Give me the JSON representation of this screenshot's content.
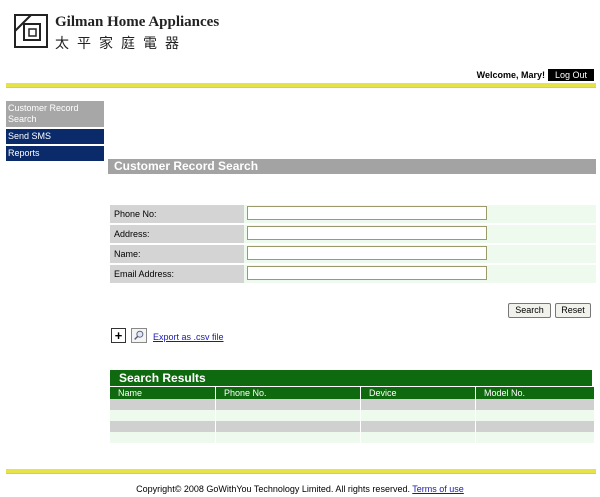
{
  "brand": {
    "name_en": "Gilman Home Appliances",
    "name_zh": "太平家庭電器"
  },
  "header": {
    "welcome": "Welcome, Mary!",
    "logout_label": "Log Out"
  },
  "sidebar": {
    "items": [
      {
        "label": "Customer Record Search"
      },
      {
        "label": "Send SMS"
      },
      {
        "label": "Reports"
      }
    ]
  },
  "section_title": "Customer Record Search",
  "form": {
    "fields": [
      {
        "label": "Phone No:",
        "value": ""
      },
      {
        "label": "Address:",
        "value": ""
      },
      {
        "label": "Name:",
        "value": ""
      },
      {
        "label": "Email Address:",
        "value": ""
      }
    ],
    "search_label": "Search",
    "reset_label": "Reset"
  },
  "export": {
    "plus_icon": "+",
    "link_label": "Export as .csv file"
  },
  "results": {
    "title": "Search Results",
    "columns": [
      "Name",
      "Phone No.",
      "Device",
      "Model No."
    ]
  },
  "footer": {
    "copyright": "Copyright© 2008 GoWithYou Technology Limited. All rights reserved.",
    "terms_label": "Terms of use"
  },
  "colors": {
    "nav_blue": "#0a2a6a",
    "results_green": "#0f6a0f",
    "bar_yellow": "#e6e24a",
    "section_gray": "#a3a3a3"
  }
}
